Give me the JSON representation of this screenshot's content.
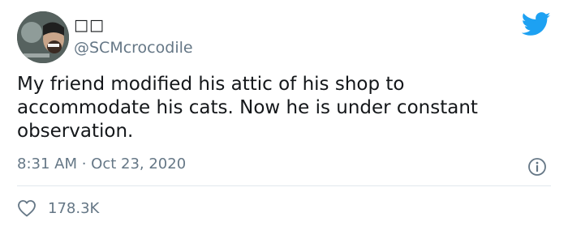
{
  "user": {
    "display_name": "□□",
    "handle": "@SCMcrocodile"
  },
  "tweet": {
    "text": "My friend modified his attic of his shop to accommodate his cats. Now he is under constant observation.",
    "timestamp": "8:31 AM · Oct 23, 2020"
  },
  "stats": {
    "likes": "178.3K"
  },
  "icons": {
    "brand": "twitter-bird-icon",
    "info": "info-icon",
    "like": "heart-icon"
  },
  "colors": {
    "brand_blue": "#1da1f2",
    "muted_text": "#657786",
    "primary_text": "#14171a",
    "divider": "#e1e8ed"
  }
}
